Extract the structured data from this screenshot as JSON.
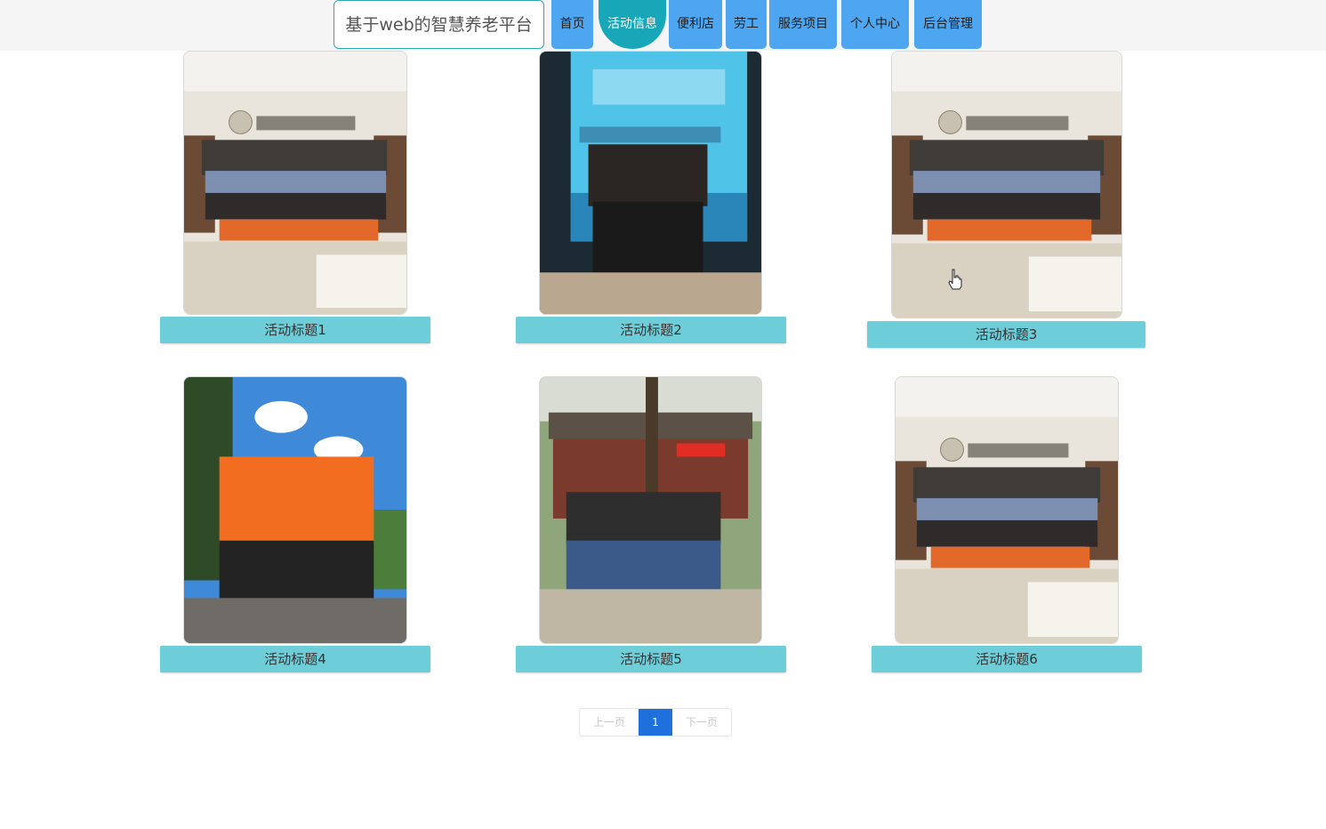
{
  "header": {
    "brand": "基于web的智慧养老平台",
    "nav": [
      {
        "label": "首页",
        "active": false
      },
      {
        "label": "活动信息",
        "active": true
      },
      {
        "label": "便利店",
        "active": false
      },
      {
        "label": "劳工",
        "active": false
      },
      {
        "label": "服务项目",
        "active": false
      },
      {
        "label": "个人中心",
        "active": false
      },
      {
        "label": "后台管理",
        "active": false
      }
    ]
  },
  "activities": [
    {
      "title": "活动标题1",
      "photo": "group-photo-hall"
    },
    {
      "title": "活动标题2",
      "photo": "group-photo-stage"
    },
    {
      "title": "活动标题3",
      "photo": "group-photo-hall"
    },
    {
      "title": "活动标题4",
      "photo": "group-photo-outdoor-vests"
    },
    {
      "title": "活动标题5",
      "photo": "group-photo-temple"
    },
    {
      "title": "活动标题6",
      "photo": "group-photo-hall"
    }
  ],
  "pagination": {
    "prev": "上一页",
    "current": "1",
    "next": "下一页"
  },
  "colors": {
    "nav_blue": "#4ea6f0",
    "nav_active": "#17a7b8",
    "caption_bg": "#6dced9",
    "pager_active": "#1f6fdc"
  }
}
